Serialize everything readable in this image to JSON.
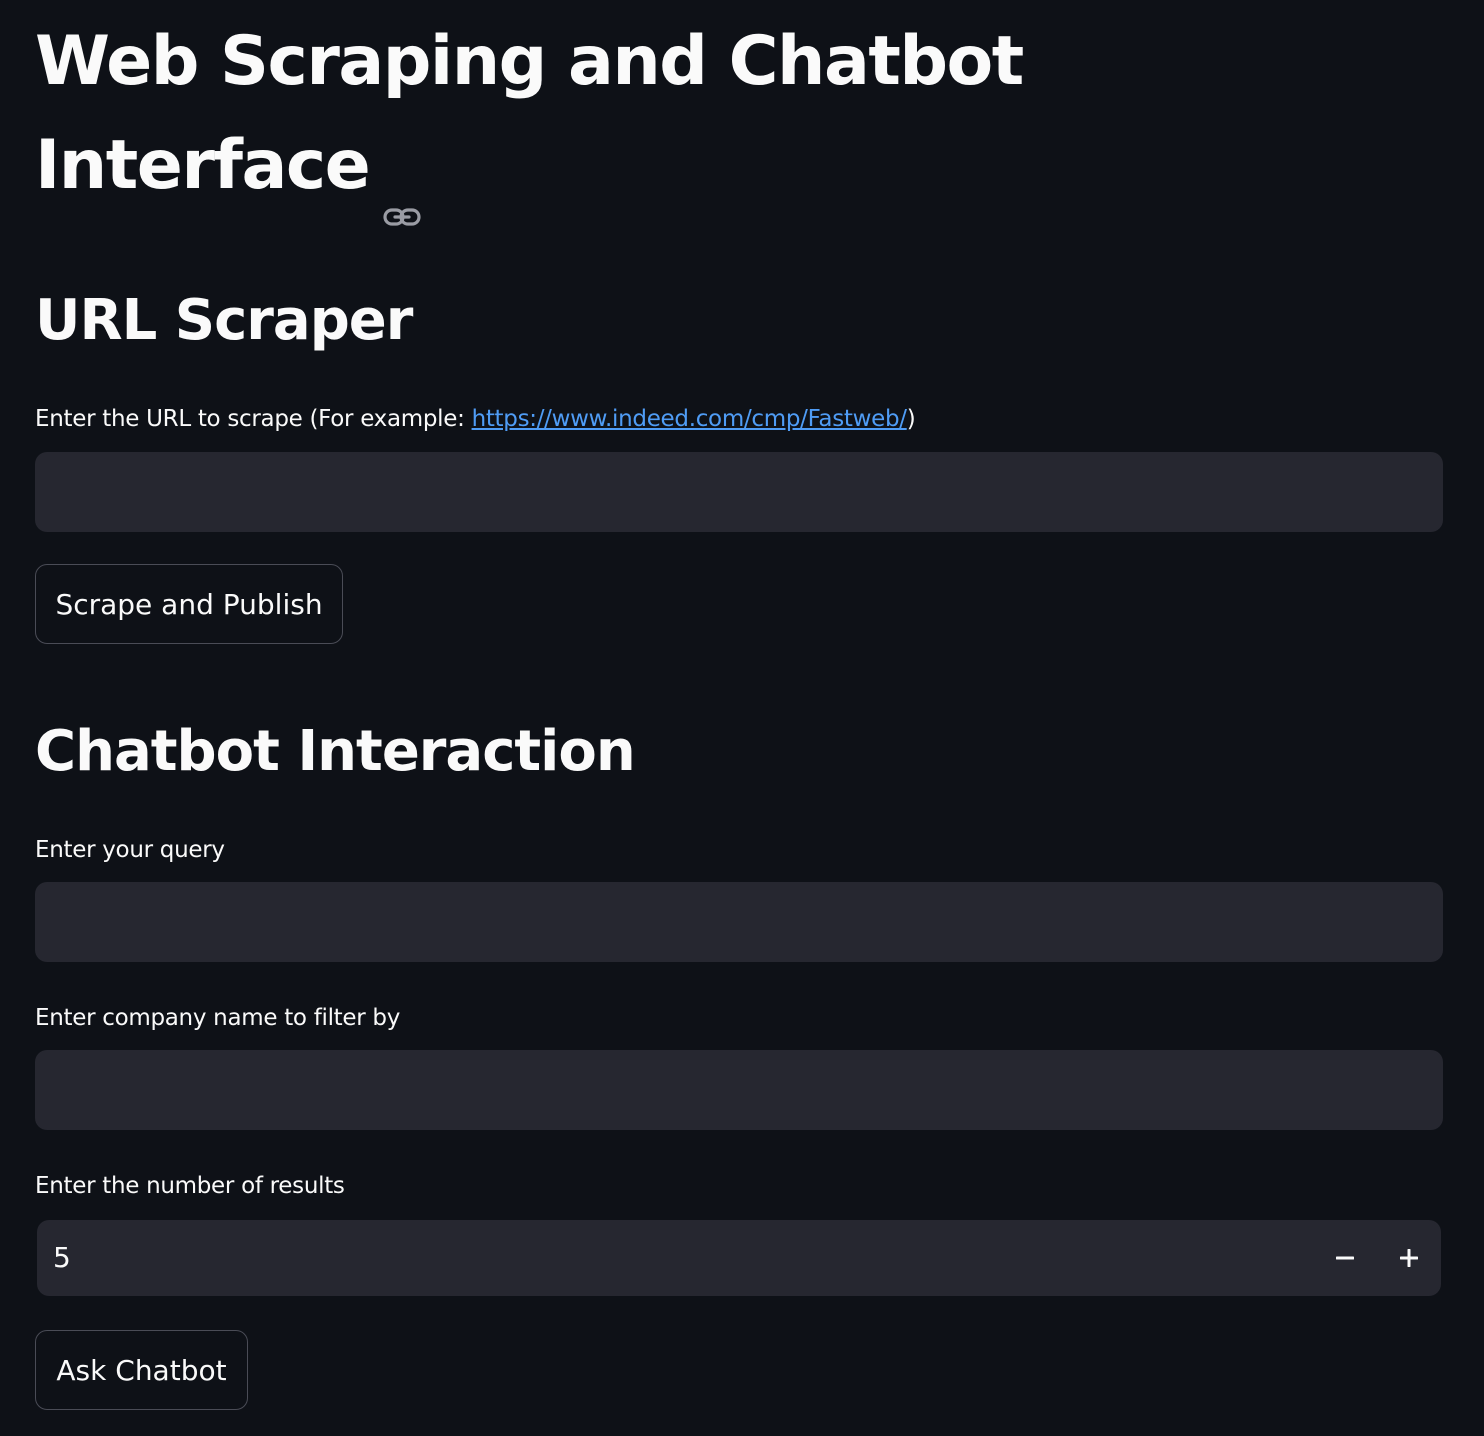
{
  "page": {
    "title": "Web Scraping and Chatbot Interface"
  },
  "url_scraper": {
    "heading": "URL Scraper",
    "url_label_prefix": "Enter the URL to scrape (For example: ",
    "url_label_link": "https://www.indeed.com/cmp/Fastweb/",
    "url_label_suffix": ")",
    "url_value": "",
    "submit_label": "Scrape and Publish"
  },
  "chatbot": {
    "heading": "Chatbot Interaction",
    "query_label": "Enter your query",
    "query_value": "",
    "company_label": "Enter company name to filter by",
    "company_value": "",
    "results_label": "Enter the number of results",
    "results_value": "5",
    "decrement_symbol": "−",
    "increment_symbol": "+",
    "submit_label": "Ask Chatbot"
  },
  "icons": {
    "title_anchor": "link-icon",
    "decrement": "minus-icon",
    "increment": "plus-icon"
  }
}
